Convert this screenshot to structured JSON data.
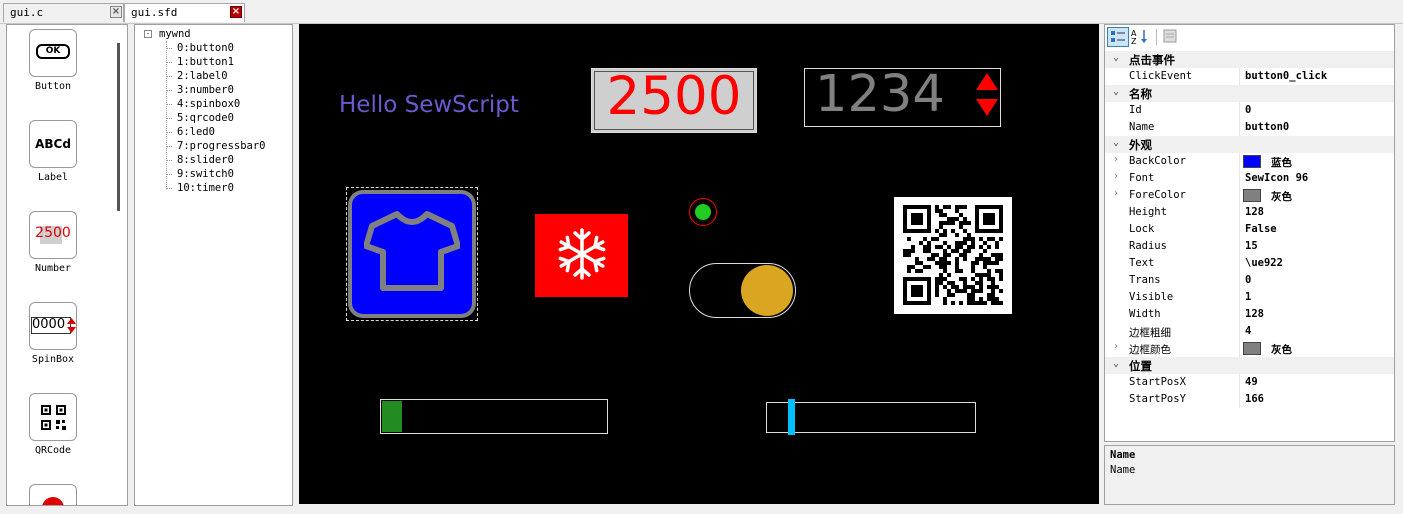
{
  "tabs": [
    {
      "label": "gui.c",
      "close": "×"
    },
    {
      "label": "gui.sfd",
      "close": "×"
    }
  ],
  "toolbox": {
    "items": [
      {
        "label": "Button",
        "icon_text": "OK"
      },
      {
        "label": "Label",
        "icon_text": "ABCd"
      },
      {
        "label": "Number",
        "icon_text": "2500"
      },
      {
        "label": "SpinBox",
        "icon_text": "0000"
      },
      {
        "label": "QRCode",
        "icon": "qrcode-icon"
      },
      {
        "label": "",
        "icon": "led-icon"
      }
    ]
  },
  "tree": {
    "root": "mywnd",
    "items": [
      "0:button0",
      "1:button1",
      "2:label0",
      "3:number0",
      "4:spinbox0",
      "5:qrcode0",
      "6:led0",
      "7:progressbar0",
      "8:slider0",
      "9:switch0",
      "10:timer0"
    ]
  },
  "canvas": {
    "label_text": "Hello SewScript",
    "number_value": "2500",
    "spinbox_value": "1234",
    "button0_icon": "tshirt-icon",
    "button1_icon": "snowflake-icon",
    "progress": 0.09,
    "slider": 0.11,
    "switch_on": true,
    "colors": {
      "button0_bg": "#0000ff",
      "button1_bg": "#ff0000",
      "label": "#6a5acd",
      "number_text": "#ff0000",
      "spinbox_text": "#808080",
      "led": "#22cc22",
      "progress": "#228b22",
      "slider_thumb": "#00bfff",
      "switch_knob": "#daa520"
    }
  },
  "properties": {
    "categories": [
      {
        "name": "点击事件",
        "rows": [
          {
            "name": "ClickEvent",
            "value": "button0_click"
          }
        ]
      },
      {
        "name": "名称",
        "rows": [
          {
            "name": "Id",
            "value": "0"
          },
          {
            "name": "Name",
            "value": "button0"
          }
        ]
      },
      {
        "name": "外观",
        "rows": [
          {
            "name": "BackColor",
            "value": "蓝色",
            "swatch": "#0000ff",
            "expand": true
          },
          {
            "name": "Font",
            "value": "SewIcon 96",
            "expand": true
          },
          {
            "name": "ForeColor",
            "value": "灰色",
            "swatch": "#808080",
            "expand": true
          },
          {
            "name": "Height",
            "value": "128"
          },
          {
            "name": "Lock",
            "value": "False"
          },
          {
            "name": "Radius",
            "value": "15"
          },
          {
            "name": "Text",
            "value": "\\ue922"
          },
          {
            "name": "Trans",
            "value": "0"
          },
          {
            "name": "Visible",
            "value": "1"
          },
          {
            "name": "Width",
            "value": "128"
          },
          {
            "name": "边框粗细",
            "value": "4"
          },
          {
            "name": "边框颜色",
            "value": "灰色",
            "swatch": "#808080",
            "expand": true
          }
        ]
      },
      {
        "name": "位置",
        "rows": [
          {
            "name": "StartPosX",
            "value": "49"
          },
          {
            "name": "StartPosY",
            "value": "166"
          }
        ]
      }
    ],
    "description": {
      "title": "Name",
      "text": "Name"
    }
  }
}
